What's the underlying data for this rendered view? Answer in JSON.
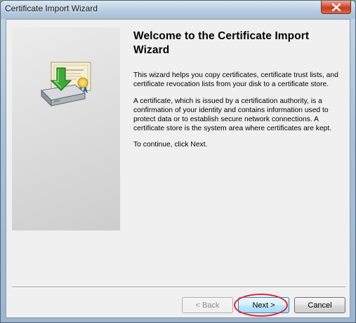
{
  "window": {
    "title": "Certificate Import Wizard",
    "close_icon": "close-icon"
  },
  "side_panel": {
    "icon": "certificate-import-icon"
  },
  "content": {
    "heading": "Welcome to the Certificate Import Wizard",
    "paragraphs": [
      "This wizard helps you copy certificates, certificate trust lists, and certificate revocation lists from your disk to a certificate store.",
      "A certificate, which is issued by a certification authority, is a confirmation of your identity and contains information used to protect data or to establish secure network connections. A certificate store is the system area where certificates are kept.",
      "To continue, click Next."
    ]
  },
  "buttons": {
    "back": "< Back",
    "next": "Next >",
    "cancel": "Cancel"
  },
  "colors": {
    "highlight": "#d9283b",
    "close_button": "#c43a1f",
    "default_button_border": "#3c7fb1"
  }
}
